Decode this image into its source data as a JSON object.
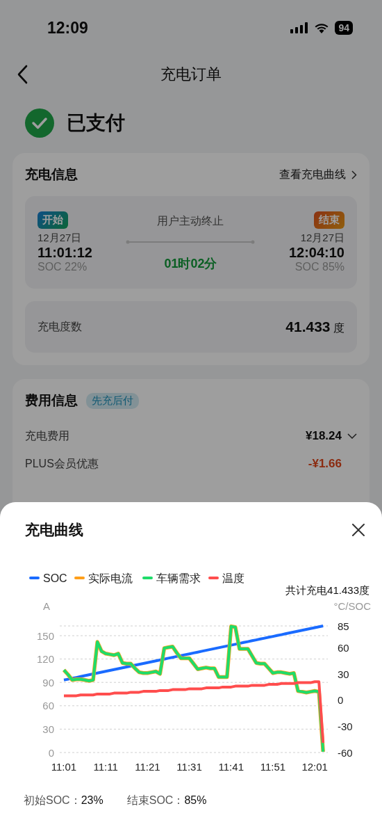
{
  "status_bar": {
    "time": "12:09",
    "battery": "94"
  },
  "nav": {
    "title": "充电订单"
  },
  "status": {
    "text": "已支付"
  },
  "charging_info": {
    "title": "充电信息",
    "link": "查看充电曲线",
    "start": {
      "tag": "开始",
      "date": "12月27日",
      "time": "11:01:12",
      "soc": "SOC 22%"
    },
    "reason": "用户主动终止",
    "duration": "01时02分",
    "end": {
      "tag": "结束",
      "date": "12月27日",
      "time": "12:04:10",
      "soc": "SOC 85%"
    },
    "energy_label": "充电度数",
    "energy_value": "41.433",
    "energy_unit": "度"
  },
  "fee_info": {
    "title": "费用信息",
    "tag": "先充后付",
    "rows": [
      {
        "label": "充电费用",
        "value": "¥18.24",
        "kind": "expandable"
      },
      {
        "label": "PLUS会员优惠",
        "value": "-¥1.66",
        "kind": "discount"
      }
    ]
  },
  "sheet": {
    "title": "充电曲线",
    "total": "共计充电41.433度",
    "chart_data": {
      "type": "line",
      "ylabel": "A",
      "y2label": "°C/SOC",
      "categories": [
        "11:01",
        null,
        null,
        null,
        null,
        null,
        null,
        null,
        null,
        null,
        "11:11",
        null,
        null,
        null,
        null,
        null,
        null,
        null,
        null,
        null,
        "11:21",
        null,
        null,
        null,
        null,
        null,
        null,
        null,
        null,
        null,
        "11:31",
        null,
        null,
        null,
        null,
        null,
        null,
        null,
        null,
        null,
        "11:41",
        null,
        null,
        null,
        null,
        null,
        null,
        null,
        null,
        null,
        "11:51",
        null,
        null,
        null,
        null,
        null,
        null,
        null,
        null,
        null,
        "12:01",
        null,
        null
      ],
      "ylim": [
        0,
        162.5
      ],
      "grid": true,
      "legend": "top",
      "yticks": [
        0,
        30,
        60,
        90,
        120,
        150
      ],
      "y2lim": [
        -60,
        85
      ],
      "y2ticks": [
        -60,
        -30,
        0,
        30,
        60,
        85
      ],
      "series": [
        {
          "name": "SOC",
          "color": "#1a6bff",
          "axis": "y2",
          "values": [
            23,
            24,
            25,
            26,
            27,
            28,
            29,
            30,
            31,
            32,
            33,
            34,
            35,
            36,
            37,
            38,
            39,
            40,
            41,
            42,
            43,
            44,
            45,
            46,
            47,
            48,
            49,
            50,
            51,
            52,
            53,
            54,
            55,
            56,
            57,
            58,
            59,
            60,
            61,
            62,
            63,
            64,
            65,
            66,
            67,
            68,
            69,
            70,
            71,
            72,
            73,
            74,
            75,
            76,
            77,
            78,
            79,
            80,
            81,
            82,
            83,
            84,
            85
          ]
        },
        {
          "name": "实际电流",
          "color": "#ff9f1a",
          "values": [
            106,
            100,
            93,
            94,
            94,
            93,
            92,
            93,
            142,
            130,
            127,
            126,
            125,
            127,
            115,
            114,
            114,
            108,
            103,
            102,
            102,
            103,
            104,
            101,
            134,
            135,
            136,
            128,
            121,
            121,
            121,
            114,
            107,
            108,
            109,
            108,
            108,
            97,
            97,
            97,
            162,
            161,
            133,
            133,
            133,
            124,
            115,
            114,
            114,
            108,
            102,
            103,
            103,
            102,
            101,
            102,
            79,
            78,
            77,
            78,
            79,
            78,
            1
          ]
        },
        {
          "name": "车辆需求",
          "color": "#1edc6a",
          "values": [
            106,
            100,
            93,
            94,
            94,
            93,
            92,
            93,
            142,
            130,
            127,
            126,
            125,
            127,
            115,
            114,
            114,
            108,
            103,
            102,
            102,
            103,
            104,
            101,
            134,
            135,
            136,
            128,
            121,
            121,
            121,
            114,
            107,
            108,
            109,
            108,
            108,
            97,
            97,
            97,
            162,
            161,
            133,
            133,
            133,
            124,
            115,
            114,
            114,
            108,
            102,
            103,
            103,
            102,
            101,
            102,
            79,
            78,
            77,
            78,
            79,
            78,
            1
          ]
        },
        {
          "name": "温度",
          "color": "#ff4d4d",
          "axis": "y2",
          "values": [
            5,
            5,
            5,
            5,
            6,
            6,
            6,
            6,
            7,
            7,
            7,
            7,
            8,
            8,
            8,
            8,
            9,
            9,
            9,
            10,
            10,
            10,
            10,
            11,
            11,
            11,
            12,
            12,
            12,
            12,
            13,
            13,
            13,
            13,
            14,
            14,
            14,
            14,
            15,
            15,
            15,
            16,
            16,
            16,
            16,
            17,
            17,
            17,
            17,
            18,
            18,
            18,
            19,
            19,
            19,
            19,
            20,
            20,
            20,
            20,
            21,
            21,
            -49
          ]
        }
      ]
    },
    "summary": [
      {
        "label": "初始SOC：",
        "value": "23%"
      },
      {
        "label": "结束SOC：",
        "value": "85%"
      }
    ]
  }
}
